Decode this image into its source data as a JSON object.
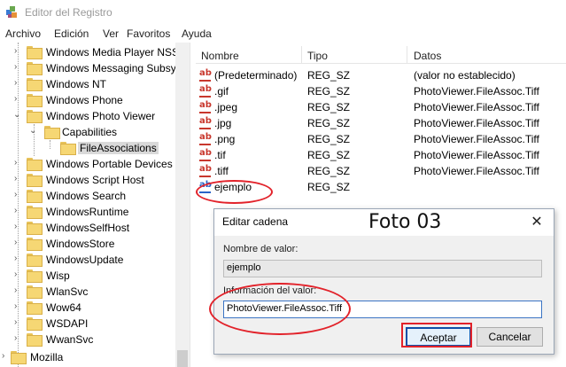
{
  "window": {
    "title": "Editor del Registro"
  },
  "menu": [
    "Archivo",
    "Edición",
    "Ver",
    "Favoritos",
    "Ayuda"
  ],
  "tree": {
    "items": [
      {
        "label": "Windows Media Player NSS",
        "state": "collapsed"
      },
      {
        "label": "Windows Messaging Subsy",
        "state": "collapsed"
      },
      {
        "label": "Windows NT",
        "state": "collapsed"
      },
      {
        "label": "Windows Phone",
        "state": "collapsed"
      },
      {
        "label": "Windows Photo Viewer",
        "state": "expanded"
      },
      {
        "label": "Capabilities",
        "state": "expanded"
      },
      {
        "label": "FileAssociations",
        "state": "selected"
      },
      {
        "label": "Windows Portable Devices",
        "state": "collapsed"
      },
      {
        "label": "Windows Script Host",
        "state": "collapsed"
      },
      {
        "label": "Windows Search",
        "state": "collapsed"
      },
      {
        "label": "WindowsRuntime",
        "state": "collapsed"
      },
      {
        "label": "WindowsSelfHost",
        "state": "collapsed"
      },
      {
        "label": "WindowsStore",
        "state": "collapsed"
      },
      {
        "label": "WindowsUpdate",
        "state": "collapsed"
      },
      {
        "label": "Wisp",
        "state": "collapsed"
      },
      {
        "label": "WlanSvc",
        "state": "collapsed"
      },
      {
        "label": "Wow64",
        "state": "collapsed"
      },
      {
        "label": "WSDAPI",
        "state": "collapsed"
      },
      {
        "label": "WwanSvc",
        "state": "collapsed"
      },
      {
        "label": "Mozilla",
        "state": "collapsed"
      }
    ]
  },
  "list": {
    "columns": [
      "Nombre",
      "Tipo",
      "Datos"
    ],
    "rows": [
      {
        "name": "(Predeterminado)",
        "type": "REG_SZ",
        "data": "(valor no establecido)",
        "icon": "string-value-icon"
      },
      {
        "name": ".gif",
        "type": "REG_SZ",
        "data": "PhotoViewer.FileAssoc.Tiff",
        "icon": "string-value-icon"
      },
      {
        "name": ".jpeg",
        "type": "REG_SZ",
        "data": "PhotoViewer.FileAssoc.Tiff",
        "icon": "string-value-icon"
      },
      {
        "name": ".jpg",
        "type": "REG_SZ",
        "data": "PhotoViewer.FileAssoc.Tiff",
        "icon": "string-value-icon"
      },
      {
        "name": ".png",
        "type": "REG_SZ",
        "data": "PhotoViewer.FileAssoc.Tiff",
        "icon": "string-value-icon"
      },
      {
        "name": ".tif",
        "type": "REG_SZ",
        "data": "PhotoViewer.FileAssoc.Tiff",
        "icon": "string-value-icon"
      },
      {
        "name": ".tiff",
        "type": "REG_SZ",
        "data": "PhotoViewer.FileAssoc.Tiff",
        "icon": "string-value-icon"
      },
      {
        "name": "ejemplo",
        "type": "REG_SZ",
        "data": "",
        "icon": "string-value-icon"
      }
    ]
  },
  "dialog": {
    "title": "Editar cadena",
    "caption": "Foto 03",
    "value_name_label": "Nombre de valor:",
    "value_name": "ejemplo",
    "value_data_label": "Información del valor:",
    "value_data": "PhotoViewer.FileAssoc.Tiff",
    "accept_label": "Aceptar",
    "cancel_label": "Cancelar",
    "close_glyph": "✕"
  },
  "colors": {
    "annotation": "#e2222a",
    "accent": "#0f4fa8",
    "folder": "#f6d774"
  }
}
